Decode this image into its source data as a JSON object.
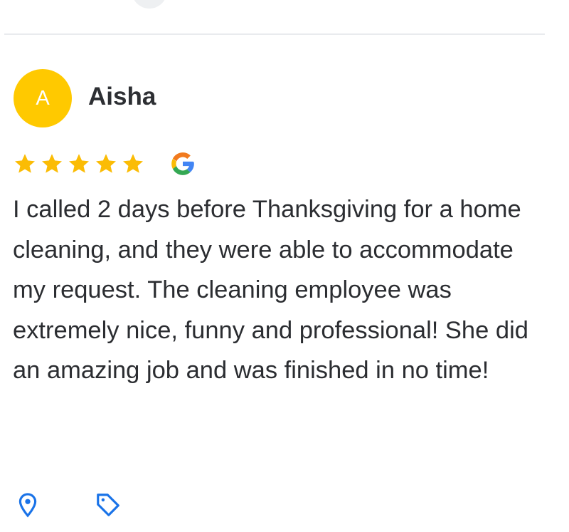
{
  "review": {
    "avatar_initial": "A",
    "reviewer_name": "Aisha",
    "rating": 5,
    "rating_max": 5,
    "source_icon": "google-icon",
    "text": "I called 2 days before Thanksgiving for a home cleaning, and they were able to accommodate my request. The cleaning employee was extremely nice, funny and professional! She did an amazing job and was finished in no time!"
  },
  "footer": {
    "icons": [
      "location-pin-icon",
      "tag-icon"
    ]
  },
  "colors": {
    "avatar": "#ffc900",
    "star": "#fbbc05",
    "text": "#2b2d31",
    "icon": "#1a73e8",
    "divider": "#e9ebee"
  }
}
